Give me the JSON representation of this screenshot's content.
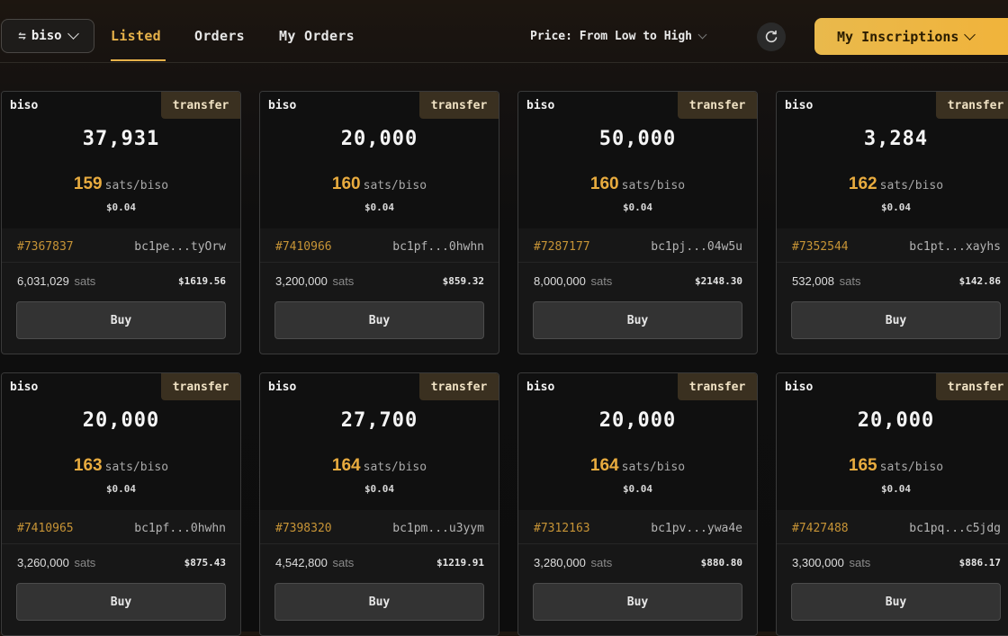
{
  "header": {
    "ticker": "biso",
    "tabs": [
      "Listed",
      "Orders",
      "My Orders"
    ],
    "active_tab": "Listed",
    "sort_label": "Price: From Low to High",
    "my_inscriptions": "My Inscriptions"
  },
  "colors": {
    "accent": "#e9ac3f",
    "badge_bg": "#3a3020",
    "button_bg": "#333333"
  },
  "cards": [
    {
      "tick": "biso",
      "badge": "transfer",
      "amount": "37,931",
      "price": "159",
      "unit": "sats/biso",
      "usd": "$0.04",
      "number": "#7367837",
      "address": "bc1pe...tyOrw",
      "total": "6,031,029",
      "total_unit": "sats",
      "total_usd": "$1619.56",
      "buy": "Buy"
    },
    {
      "tick": "biso",
      "badge": "transfer",
      "amount": "20,000",
      "price": "160",
      "unit": "sats/biso",
      "usd": "$0.04",
      "number": "#7410966",
      "address": "bc1pf...0hwhn",
      "total": "3,200,000",
      "total_unit": "sats",
      "total_usd": "$859.32",
      "buy": "Buy"
    },
    {
      "tick": "biso",
      "badge": "transfer",
      "amount": "50,000",
      "price": "160",
      "unit": "sats/biso",
      "usd": "$0.04",
      "number": "#7287177",
      "address": "bc1pj...04w5u",
      "total": "8,000,000",
      "total_unit": "sats",
      "total_usd": "$2148.30",
      "buy": "Buy"
    },
    {
      "tick": "biso",
      "badge": "transfer",
      "amount": "3,284",
      "price": "162",
      "unit": "sats/biso",
      "usd": "$0.04",
      "number": "#7352544",
      "address": "bc1pt...xayhs",
      "total": "532,008",
      "total_unit": "sats",
      "total_usd": "$142.86",
      "buy": "Buy"
    },
    {
      "tick": "biso",
      "badge": "transfer",
      "amount": "20,000",
      "price": "163",
      "unit": "sats/biso",
      "usd": "$0.04",
      "number": "#7410965",
      "address": "bc1pf...0hwhn",
      "total": "3,260,000",
      "total_unit": "sats",
      "total_usd": "$875.43",
      "buy": "Buy"
    },
    {
      "tick": "biso",
      "badge": "transfer",
      "amount": "27,700",
      "price": "164",
      "unit": "sats/biso",
      "usd": "$0.04",
      "number": "#7398320",
      "address": "bc1pm...u3yym",
      "total": "4,542,800",
      "total_unit": "sats",
      "total_usd": "$1219.91",
      "buy": "Buy"
    },
    {
      "tick": "biso",
      "badge": "transfer",
      "amount": "20,000",
      "price": "164",
      "unit": "sats/biso",
      "usd": "$0.04",
      "number": "#7312163",
      "address": "bc1pv...ywa4e",
      "total": "3,280,000",
      "total_unit": "sats",
      "total_usd": "$880.80",
      "buy": "Buy"
    },
    {
      "tick": "biso",
      "badge": "transfer",
      "amount": "20,000",
      "price": "165",
      "unit": "sats/biso",
      "usd": "$0.04",
      "number": "#7427488",
      "address": "bc1pq...c5jdg",
      "total": "3,300,000",
      "total_unit": "sats",
      "total_usd": "$886.17",
      "buy": "Buy"
    }
  ]
}
